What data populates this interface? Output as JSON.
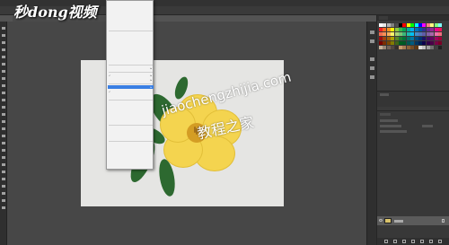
{
  "app": {
    "menubar_color": "#323232",
    "doc_tab_title": ""
  },
  "watermarks": {
    "site_logo": "秒dong视频",
    "url": "jiaochengzhijia.com",
    "cn": "教程之家"
  },
  "menu": {
    "items": [
      {
        "label": "",
        "shortcut": "",
        "type": "item"
      },
      {
        "label": "",
        "shortcut": "",
        "type": "item"
      },
      {
        "label": "",
        "shortcut": "",
        "type": "item"
      },
      {
        "label": "",
        "shortcut": "",
        "type": "item"
      },
      {
        "label": "",
        "shortcut": "",
        "type": "item-disabled"
      },
      {
        "label": "",
        "shortcut": "",
        "type": "item-disabled"
      },
      {
        "label": "",
        "shortcut": "",
        "type": "separator"
      },
      {
        "label": "",
        "shortcut": "",
        "type": "item"
      },
      {
        "label": "",
        "shortcut": "",
        "type": "item"
      },
      {
        "label": "",
        "shortcut": "",
        "type": "item"
      },
      {
        "label": "",
        "shortcut": "",
        "type": "item"
      },
      {
        "label": "",
        "shortcut": "",
        "type": "item"
      },
      {
        "label": "",
        "shortcut": "",
        "type": "item"
      },
      {
        "label": "",
        "shortcut": "",
        "type": "item"
      },
      {
        "label": "",
        "shortcut": "",
        "type": "separator"
      },
      {
        "label": "",
        "shortcut": "",
        "type": "item-sub"
      },
      {
        "label": "",
        "shortcut": "",
        "type": "separator"
      },
      {
        "label": "",
        "shortcut": "",
        "type": "item-checked-sub"
      },
      {
        "label": "",
        "shortcut": "",
        "type": "item-sub"
      },
      {
        "label": "",
        "shortcut": "",
        "type": "separator"
      },
      {
        "label": "",
        "shortcut": "",
        "type": "item-highlight"
      },
      {
        "label": "",
        "shortcut": "",
        "type": "item-checked"
      },
      {
        "label": "",
        "shortcut": "",
        "type": "item"
      },
      {
        "label": "",
        "shortcut": "",
        "type": "separator"
      },
      {
        "label": "",
        "shortcut": "",
        "type": "item"
      },
      {
        "label": "",
        "shortcut": "",
        "type": "item"
      },
      {
        "label": "",
        "shortcut": "",
        "type": "item-disabled"
      },
      {
        "label": "",
        "shortcut": "",
        "type": "item-disabled"
      },
      {
        "label": "",
        "shortcut": "",
        "type": "item-disabled"
      },
      {
        "label": "",
        "shortcut": "",
        "type": "separator"
      },
      {
        "label": "",
        "shortcut": "",
        "type": "item"
      },
      {
        "label": "",
        "shortcut": "",
        "type": "item"
      },
      {
        "label": "",
        "shortcut": "",
        "type": "item-disabled"
      },
      {
        "label": "",
        "shortcut": "",
        "type": "separator"
      },
      {
        "label": "",
        "shortcut": "",
        "type": "item"
      },
      {
        "label": "",
        "shortcut": "",
        "type": "item"
      }
    ],
    "highlight_color": "#3a7fe3"
  },
  "swatch_colors": [
    "#ffffff",
    "#e6e6e6",
    "#b3b3b3",
    "#808080",
    "#4d4d4d",
    "#000000",
    "#ff0000",
    "#ffff00",
    "#00ff00",
    "#00ffff",
    "#0000ff",
    "#ff00ff",
    "#ff8080",
    "#ffff80",
    "#80ff80",
    "#80ffff",
    "#ed1c24",
    "#f26522",
    "#f7941d",
    "#fff200",
    "#8dc63f",
    "#39b54a",
    "#00a651",
    "#00a99d",
    "#00aeef",
    "#0072bc",
    "#0054a6",
    "#2e3192",
    "#662d91",
    "#92278f",
    "#ec008c",
    "#ed145b",
    "#f26c4f",
    "#f68e56",
    "#fbaf5d",
    "#fff568",
    "#acd373",
    "#7cc576",
    "#3bb878",
    "#1abbb4",
    "#00bff3",
    "#438ccb",
    "#5574b9",
    "#605ca8",
    "#8560a8",
    "#a864a8",
    "#f06eaa",
    "#f26d7d",
    "#9e0b0f",
    "#a0410d",
    "#a36209",
    "#aba000",
    "#598527",
    "#1a7b30",
    "#007236",
    "#00746b",
    "#0076a3",
    "#004b80",
    "#003471",
    "#1b1464",
    "#440e62",
    "#630460",
    "#9e005d",
    "#9e0039",
    "#790000",
    "#7b2e00",
    "#7d4900",
    "#827b00",
    "#406618",
    "#005e20",
    "#005826",
    "#005952",
    "#005b7f",
    "#003663",
    "#002157",
    "#0d004c",
    "#32004b",
    "#4b0049",
    "#7b0046",
    "#7a0026",
    "#c7b299",
    "#998675",
    "#736357",
    "#534741",
    "#37302a",
    "#c69c6d",
    "#a67c52",
    "#8c6239",
    "#754c24",
    "#603913",
    "#e0e0e0",
    "#c0c0c0",
    "#a0a0a0",
    "#707070",
    "#404040",
    "#202020"
  ]
}
